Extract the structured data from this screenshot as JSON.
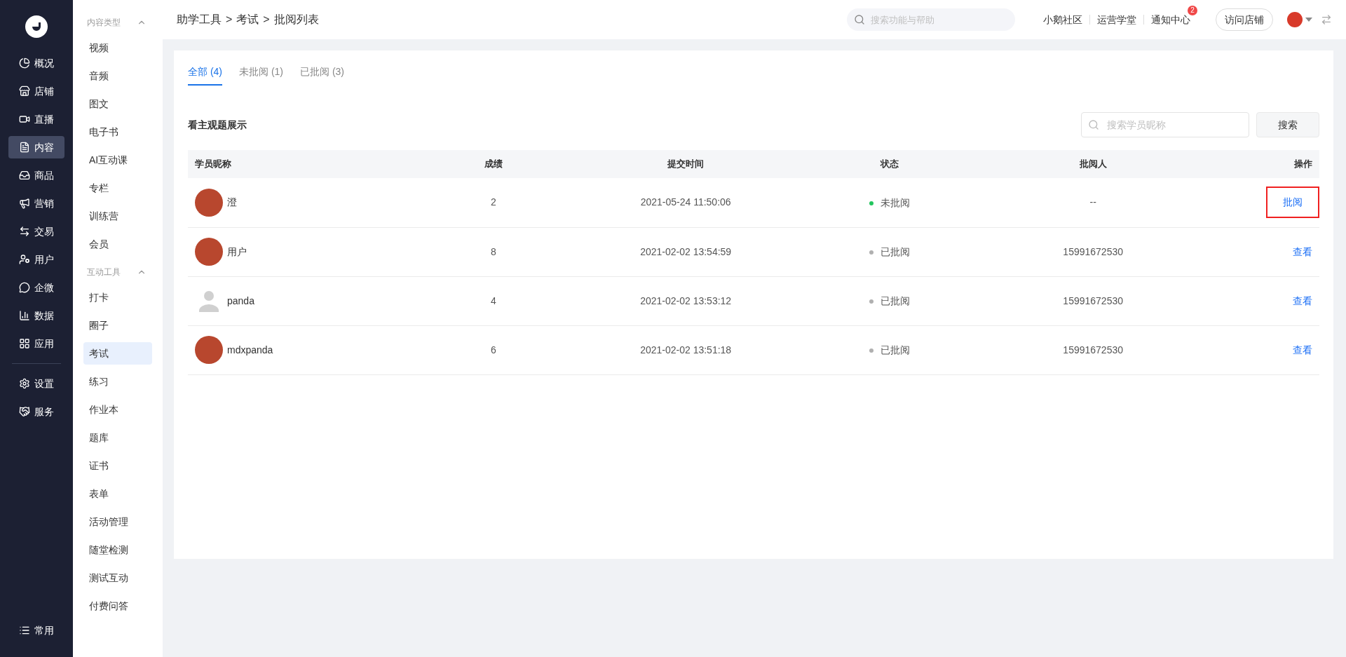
{
  "nav": {
    "items": [
      {
        "label": "概况",
        "selected": false
      },
      {
        "label": "店铺",
        "selected": false
      },
      {
        "label": "直播",
        "selected": false
      },
      {
        "label": "内容",
        "selected": true
      },
      {
        "label": "商品",
        "selected": false
      },
      {
        "label": "营销",
        "selected": false
      },
      {
        "label": "交易",
        "selected": false
      },
      {
        "label": "用户",
        "selected": false
      },
      {
        "label": "企微",
        "selected": false
      },
      {
        "label": "数据",
        "selected": false
      },
      {
        "label": "应用",
        "selected": false
      }
    ],
    "bottom_items": [
      {
        "label": "设置"
      },
      {
        "label": "服务"
      }
    ],
    "footer": {
      "label": "常用"
    }
  },
  "subnav": {
    "sections": [
      {
        "title": "内容类型",
        "expanded": true,
        "items": [
          {
            "label": "视频",
            "selected": false
          },
          {
            "label": "音频",
            "selected": false
          },
          {
            "label": "图文",
            "selected": false
          },
          {
            "label": "电子书",
            "selected": false
          },
          {
            "label": "AI互动课",
            "selected": false
          },
          {
            "label": "专栏",
            "selected": false
          },
          {
            "label": "训练营",
            "selected": false
          },
          {
            "label": "会员",
            "selected": false
          }
        ]
      },
      {
        "title": "互动工具",
        "expanded": true,
        "items": [
          {
            "label": "打卡",
            "selected": false
          },
          {
            "label": "圈子",
            "selected": false
          },
          {
            "label": "考试",
            "selected": true
          },
          {
            "label": "练习",
            "selected": false
          },
          {
            "label": "作业本",
            "selected": false
          },
          {
            "label": "题库",
            "selected": false
          },
          {
            "label": "证书",
            "selected": false
          },
          {
            "label": "表单",
            "selected": false
          },
          {
            "label": "活动管理",
            "selected": false
          },
          {
            "label": "随堂检测",
            "selected": false
          },
          {
            "label": "测试互动",
            "selected": false
          },
          {
            "label": "付费问答",
            "selected": false
          }
        ]
      }
    ]
  },
  "topbar": {
    "breadcrumb": [
      "助学工具",
      "考试",
      "批阅列表"
    ],
    "separator": ">",
    "search": {
      "placeholder": "搜索功能与帮助"
    },
    "links": [
      {
        "label": "小鹅社区"
      },
      {
        "label": "运营学堂"
      },
      {
        "label": "通知中心",
        "badge": "2"
      }
    ],
    "visit_button": "访问店铺"
  },
  "tabs": [
    {
      "label": "全部 (4)",
      "selected": true
    },
    {
      "label": "未批阅 (1)",
      "selected": false
    },
    {
      "label": "已批阅 (3)",
      "selected": false
    }
  ],
  "toolbar": {
    "title": "看主观题展示",
    "search": {
      "placeholder": "搜索学员昵称"
    },
    "button": "搜索"
  },
  "table": {
    "columns": [
      "学员昵称",
      "成绩",
      "提交时间",
      "状态",
      "批阅人",
      "操作"
    ],
    "rows": [
      {
        "kind": "photo",
        "name": "澄",
        "score": "2",
        "time": "2021-05-24 11:50:06",
        "status": "未批阅",
        "color": "#22c55e",
        "reviewer": "--",
        "action": "批阅",
        "highlighted": true
      },
      {
        "kind": "photo",
        "name": "用户",
        "score": "8",
        "time": "2021-02-02 13:54:59",
        "status": "已批阅",
        "color": "#b0b0b0",
        "reviewer": "15991672530",
        "action": "查看",
        "highlighted": false
      },
      {
        "kind": "default",
        "name": "panda",
        "score": "4",
        "time": "2021-02-02 13:53:12",
        "status": "已批阅",
        "color": "#b0b0b0",
        "reviewer": "15991672530",
        "action": "查看",
        "highlighted": false
      },
      {
        "kind": "photo",
        "name": "mdxpanda",
        "score": "6",
        "time": "2021-02-02 13:51:18",
        "status": "已批阅",
        "color": "#b0b0b0",
        "reviewer": "15991672530",
        "action": "查看",
        "highlighted": false
      }
    ]
  }
}
